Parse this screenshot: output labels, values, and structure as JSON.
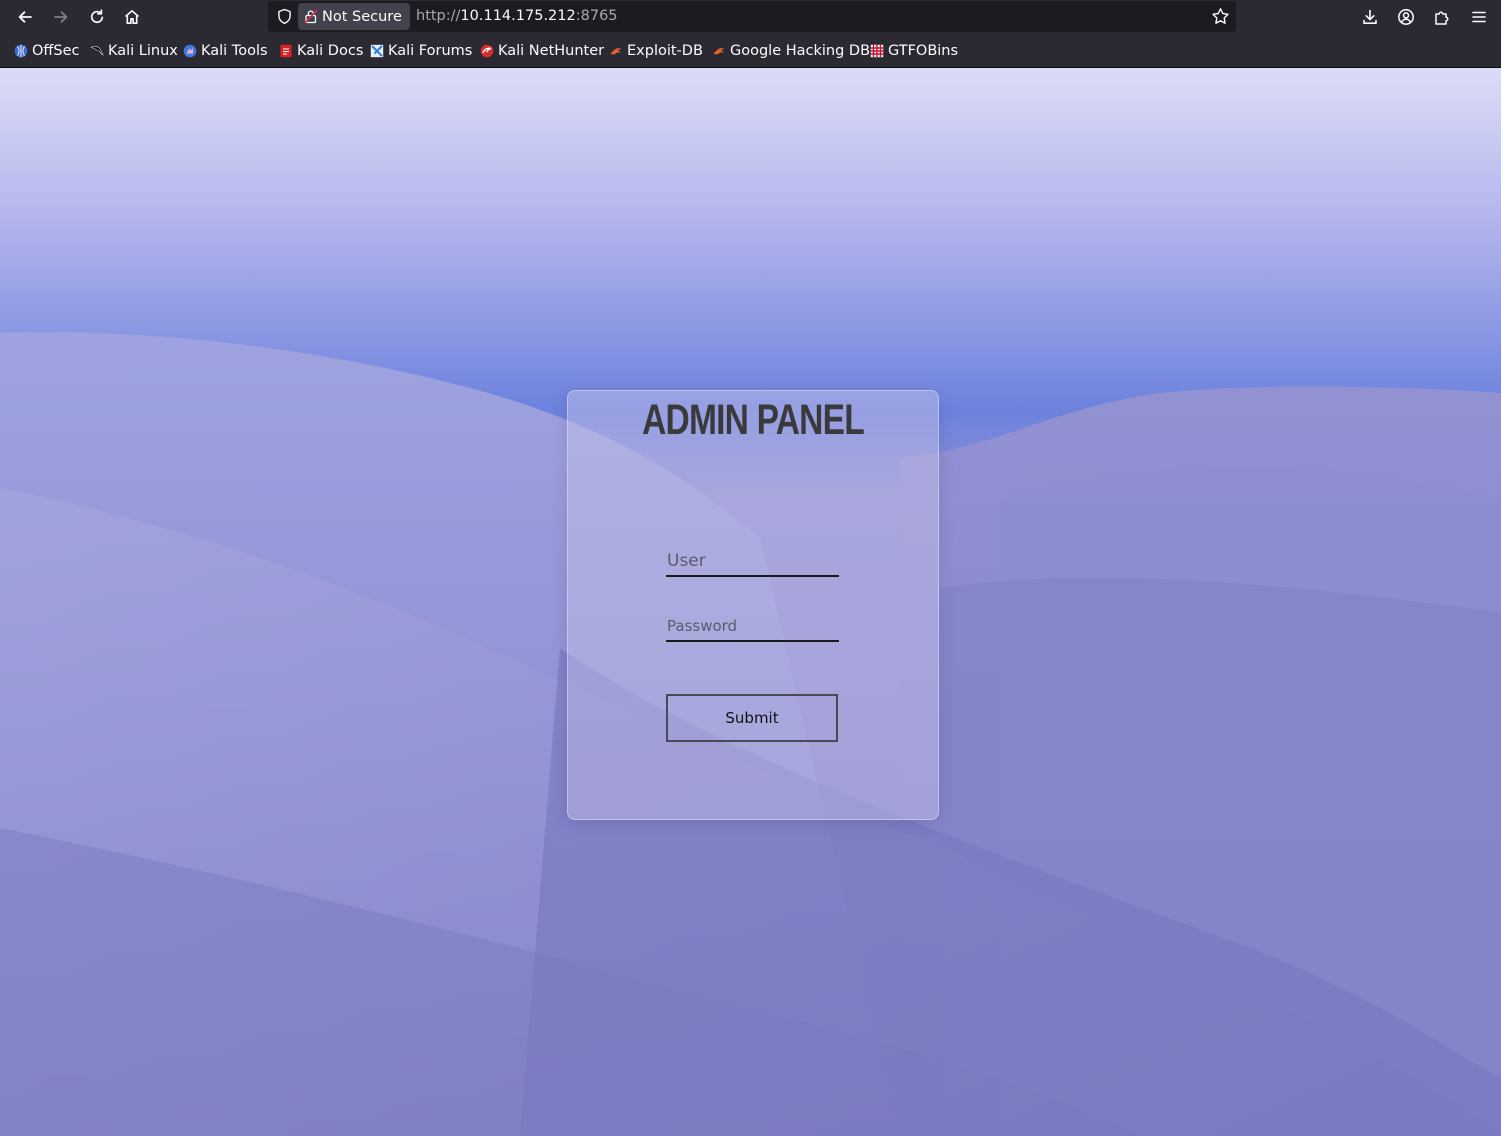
{
  "browser": {
    "security_label": "Not Secure",
    "url_scheme": "http://",
    "url_host": "10.114.175.212",
    "url_port": ":8765",
    "bookmarks": [
      {
        "label": "OffSec",
        "icon": "offsec-icon",
        "color": "#3b6cd6"
      },
      {
        "label": "Kali Linux",
        "icon": "kali-dragon-icon",
        "color": "#111111"
      },
      {
        "label": "Kali Tools",
        "icon": "kali-tools-icon",
        "color": "#3d7be0"
      },
      {
        "label": "Kali Docs",
        "icon": "kali-docs-icon",
        "color": "#d92323"
      },
      {
        "label": "Kali Forums",
        "icon": "kali-forums-icon",
        "color": "#2b7bdf"
      },
      {
        "label": "Kali NetHunter",
        "icon": "nethunter-icon",
        "color": "#d62e2e"
      },
      {
        "label": "Exploit-DB",
        "icon": "exploit-db-icon",
        "color": "#e0622a"
      },
      {
        "label": "Google Hacking DB",
        "icon": "ghdb-icon",
        "color": "#e0622a"
      },
      {
        "label": "GTFOBins",
        "icon": "gtfobins-icon",
        "color": "#c8102e"
      }
    ]
  },
  "login": {
    "title": "ADMIN PANEL",
    "user_placeholder": "User",
    "password_placeholder": "Password",
    "submit_label": "Submit"
  },
  "colors": {
    "chrome_bg": "#2b2a33",
    "urlbar_bg": "#1c1b22",
    "sky_top": "#dcdcf6",
    "horizon": "#6c82dd",
    "dunes": "#8282c8"
  }
}
